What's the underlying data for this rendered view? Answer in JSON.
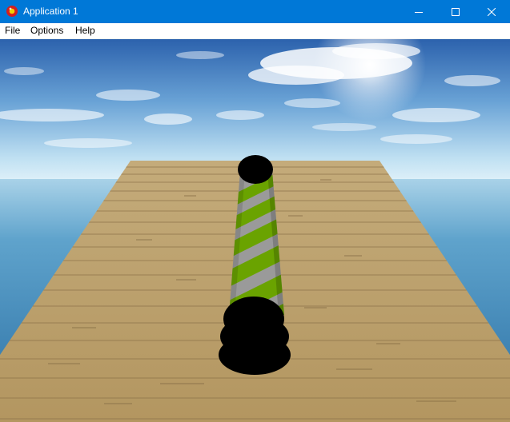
{
  "window": {
    "title": "Application 1",
    "icon": "app-red-ball-icon",
    "controls": {
      "minimize_icon": "minimize-icon",
      "maximize_icon": "maximize-icon",
      "close_icon": "close-icon"
    }
  },
  "menu": {
    "items": [
      {
        "label": "File"
      },
      {
        "label": "Options"
      },
      {
        "label": "Help"
      }
    ]
  },
  "scene": {
    "sky_top": "#2f67b0",
    "sky_horizon": "#d6ecf7",
    "sea_color": "#3b86b5",
    "deck_color": "#b59a68",
    "stripe_green": "#6aa300",
    "stripe_grey": "#9a9a9a",
    "end_cap": "#000000"
  }
}
